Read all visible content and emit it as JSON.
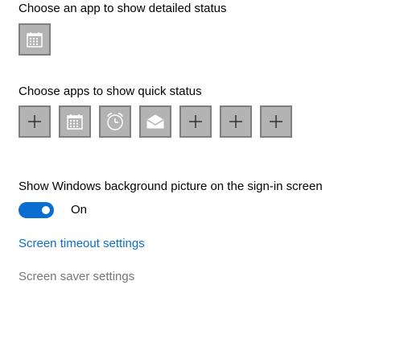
{
  "detailed_status": {
    "heading": "Choose an app to show detailed status",
    "tiles": [
      {
        "icon": "calendar-icon"
      }
    ]
  },
  "quick_status": {
    "heading": "Choose apps to show quick status",
    "tiles": [
      {
        "icon": "plus-icon"
      },
      {
        "icon": "calendar-icon"
      },
      {
        "icon": "alarm-clock-icon"
      },
      {
        "icon": "mail-icon"
      },
      {
        "icon": "plus-icon"
      },
      {
        "icon": "plus-icon"
      },
      {
        "icon": "plus-icon"
      }
    ]
  },
  "background_picture": {
    "heading": "Show Windows background picture on the sign-in screen",
    "toggle_state": "On",
    "toggle_on": true
  },
  "links": {
    "screen_timeout": "Screen timeout settings",
    "screen_saver": "Screen saver settings"
  },
  "colors": {
    "accent": "#0a6ed1",
    "tile_fill": "#b3b3b3",
    "tile_border": "#7f7f7f",
    "disabled_text": "#767676"
  }
}
